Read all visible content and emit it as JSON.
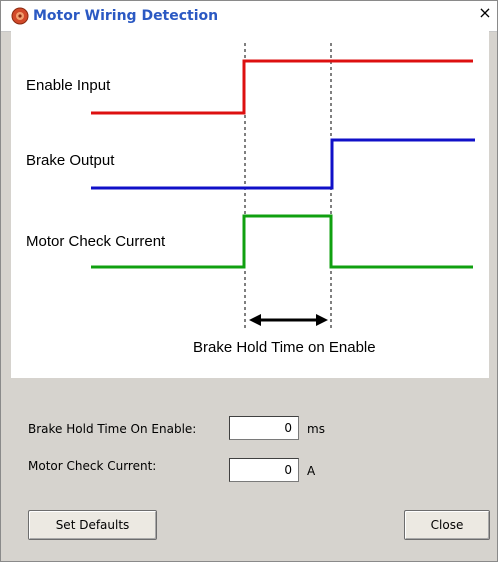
{
  "window": {
    "title": "Motor Wiring Detection",
    "close_glyph": "×"
  },
  "diagram": {
    "signals": [
      {
        "label": "Enable Input",
        "color": "#dd1010"
      },
      {
        "label": "Brake Output",
        "color": "#1010c8"
      },
      {
        "label": "Motor Check Current",
        "color": "#10a010"
      }
    ],
    "interval_label": "Brake Hold Time on Enable"
  },
  "form": {
    "brake_hold_label": "Brake Hold Time On Enable:",
    "brake_hold_value": "0",
    "brake_hold_unit": "ms",
    "motor_check_label": "Motor Check Current:",
    "motor_check_value": "0",
    "motor_check_unit": "A"
  },
  "buttons": {
    "set_defaults": "Set Defaults",
    "close": "Close"
  },
  "icons": {
    "app_icon": "motor-icon",
    "close_icon": "close-icon"
  }
}
